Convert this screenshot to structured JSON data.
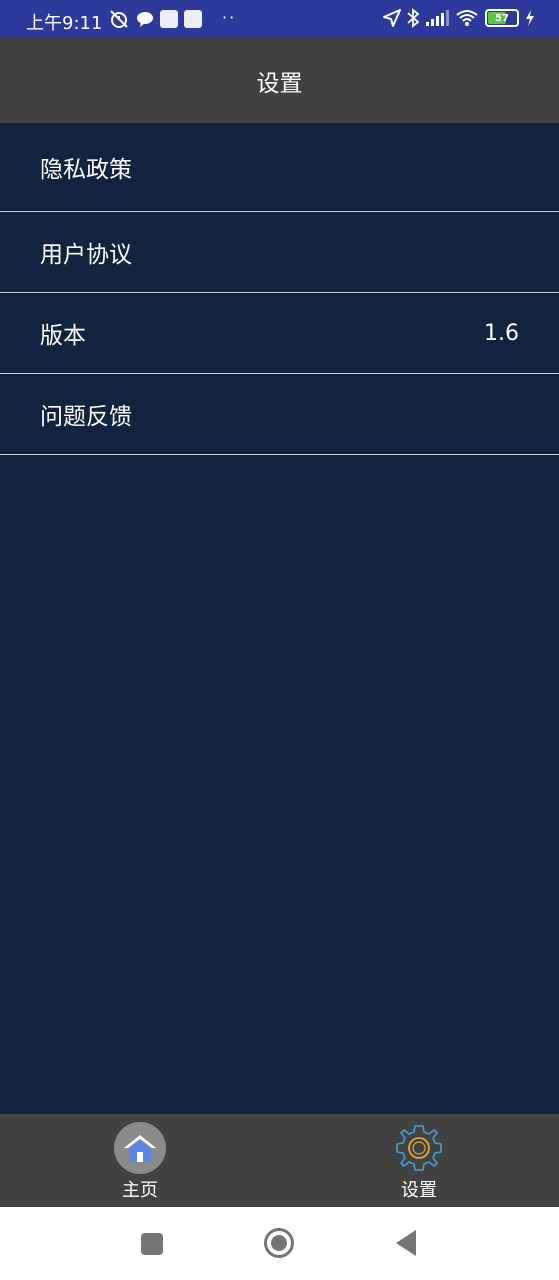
{
  "status_bar": {
    "time": "上午9:11",
    "battery": "57",
    "accent": "#2d3a9c"
  },
  "header": {
    "title": "设置"
  },
  "menu": {
    "items": [
      {
        "label": "隐私政策",
        "value": ""
      },
      {
        "label": "用户协议",
        "value": ""
      },
      {
        "label": "版本",
        "value": "1.6"
      },
      {
        "label": "问题反馈",
        "value": ""
      }
    ]
  },
  "bottom_nav": {
    "tabs": [
      {
        "label": "主页",
        "icon": "home-icon"
      },
      {
        "label": "设置",
        "icon": "gear-icon"
      }
    ]
  },
  "system_nav": {
    "buttons": [
      "recents-icon",
      "home-circle-icon",
      "back-icon"
    ]
  },
  "colors": {
    "background": "#12233f",
    "header": "#424242",
    "nav_bar": "#424242"
  }
}
